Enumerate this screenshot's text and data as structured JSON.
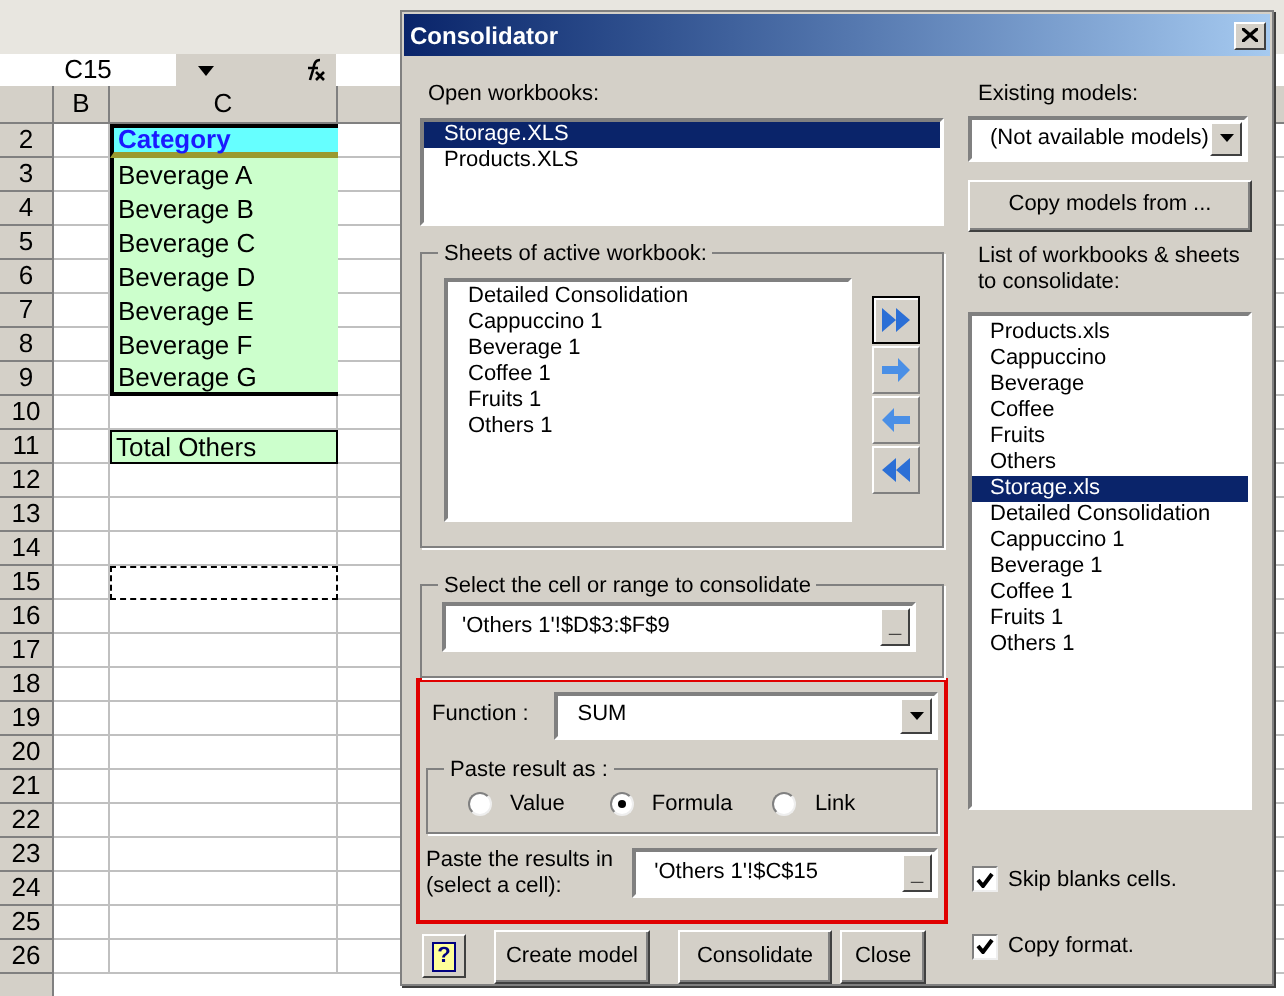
{
  "formula_bar": {
    "name_box": "C15"
  },
  "sheet": {
    "columns": [
      "B",
      "C"
    ],
    "rows": [
      {
        "number": "2",
        "text": "Category",
        "kind": "header"
      },
      {
        "number": "3",
        "text": "Beverage A",
        "kind": "item"
      },
      {
        "number": "4",
        "text": "Beverage B",
        "kind": "item"
      },
      {
        "number": "5",
        "text": "Beverage C",
        "kind": "item"
      },
      {
        "number": "6",
        "text": "Beverage D",
        "kind": "item"
      },
      {
        "number": "7",
        "text": "Beverage E",
        "kind": "item"
      },
      {
        "number": "8",
        "text": "Beverage F",
        "kind": "item"
      },
      {
        "number": "9",
        "text": "Beverage G",
        "kind": "item"
      },
      {
        "number": "10",
        "kind": "empty"
      },
      {
        "number": "11",
        "text": "Total Others",
        "kind": "total"
      },
      {
        "number": "12",
        "kind": "empty"
      },
      {
        "number": "13",
        "kind": "empty"
      },
      {
        "number": "14",
        "kind": "empty"
      },
      {
        "number": "15",
        "kind": "marquee"
      },
      {
        "number": "16",
        "kind": "empty"
      },
      {
        "number": "17",
        "kind": "empty"
      },
      {
        "number": "18",
        "kind": "empty"
      },
      {
        "number": "19",
        "kind": "empty"
      },
      {
        "number": "20",
        "kind": "empty"
      },
      {
        "number": "21",
        "kind": "empty"
      },
      {
        "number": "22",
        "kind": "empty"
      },
      {
        "number": "23",
        "kind": "empty"
      },
      {
        "number": "24",
        "kind": "empty"
      },
      {
        "number": "25",
        "kind": "empty"
      },
      {
        "number": "26",
        "kind": "empty"
      }
    ]
  },
  "dialog": {
    "title": "Consolidator",
    "open_workbooks": {
      "label": "Open workbooks:",
      "items": [
        {
          "text": "Storage.XLS",
          "selected": true
        },
        {
          "text": "Products.XLS",
          "selected": false
        }
      ]
    },
    "sheets": {
      "label": "Sheets of active workbook:",
      "items": [
        {
          "text": "Detailed Consolidation",
          "selected": false
        },
        {
          "text": "Cappuccino 1",
          "selected": false
        },
        {
          "text": "Beverage 1",
          "selected": false
        },
        {
          "text": "Coffee 1",
          "selected": false
        },
        {
          "text": "Fruits 1",
          "selected": false
        },
        {
          "text": "Others 1",
          "selected": false
        }
      ]
    },
    "range": {
      "label": "Select the cell or range to consolidate",
      "value": "'Others 1'!$D$3:$F$9",
      "button": "_"
    },
    "function": {
      "label": "Function :",
      "value": "SUM"
    },
    "paste_as": {
      "label": "Paste result as :",
      "options": [
        {
          "text": "Value",
          "selected": false
        },
        {
          "text": "Formula",
          "selected": true
        },
        {
          "text": "Link",
          "selected": false
        }
      ]
    },
    "paste_in": {
      "label": "Paste the results in (select a cell):",
      "value": "'Others 1'!$C$15",
      "button": "_"
    },
    "help_button": "?",
    "buttons": [
      "Create model",
      "Consolidate",
      "Close"
    ],
    "existing_models": {
      "label": "Existing models:",
      "value": "(Not available models)"
    },
    "copy_models_button": "Copy models from ...",
    "consolidate_list": {
      "label": "List of workbooks & sheets to consolidate:",
      "items": [
        {
          "text": "Products.xls",
          "selected": false
        },
        {
          "text": "Cappuccino",
          "selected": false
        },
        {
          "text": "Beverage",
          "selected": false
        },
        {
          "text": "Coffee",
          "selected": false
        },
        {
          "text": "Fruits",
          "selected": false
        },
        {
          "text": "Others",
          "selected": false
        },
        {
          "text": "Storage.xls",
          "selected": true
        },
        {
          "text": "Detailed Consolidation",
          "selected": false
        },
        {
          "text": "Cappuccino 1",
          "selected": false
        },
        {
          "text": "Beverage 1",
          "selected": false
        },
        {
          "text": "Coffee 1",
          "selected": false
        },
        {
          "text": "Fruits 1",
          "selected": false
        },
        {
          "text": "Others 1",
          "selected": false
        }
      ]
    },
    "checkboxes": [
      {
        "text": "Skip blanks cells.",
        "checked": true
      },
      {
        "text": "Copy format.",
        "checked": true
      }
    ]
  }
}
